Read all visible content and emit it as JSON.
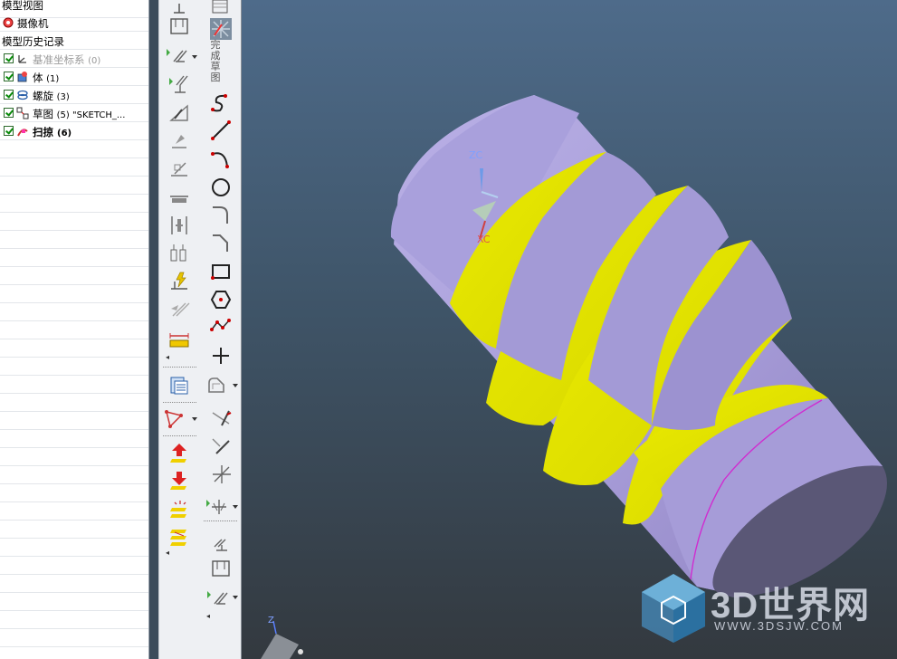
{
  "navigator": {
    "rows": [
      {
        "label": "模型视图"
      },
      {
        "label": "摄像机"
      },
      {
        "label": "模型历史记录"
      },
      {
        "label": "基准坐标系",
        "count": "(0)"
      },
      {
        "label": "体",
        "count": "(1)"
      },
      {
        "label": "螺旋",
        "count": "(3)"
      },
      {
        "label": "草图",
        "count": "(5) \"SKETCH_..."
      },
      {
        "label": "扫掠",
        "count": "(6)"
      }
    ]
  },
  "toolbar": {
    "sketch_label": "完成草图",
    "icons": [
      "dimension-icon",
      "dialog-icon",
      "constraint-icon",
      "relation-icon",
      "draw-line-icon",
      "arc-icon",
      "circle-icon",
      "fillet-icon",
      "chamfer-icon",
      "rectangle-icon",
      "polygon-icon",
      "studio-spline-icon",
      "point-icon",
      "offset-curve-icon",
      "trim-icon",
      "extend-icon",
      "corner-icon",
      "mirror-icon"
    ]
  },
  "viewport": {
    "axis_zc": "ZC",
    "axis_xc": "XC",
    "axis_z": "Z",
    "colors": {
      "body": "#a59ad6",
      "thread": "#e7e700",
      "background_top": "#4e6b8a",
      "background_bottom": "#33393f"
    }
  },
  "watermark": {
    "title": "3D世界网",
    "url": "WWW.3DSJW.COM"
  }
}
